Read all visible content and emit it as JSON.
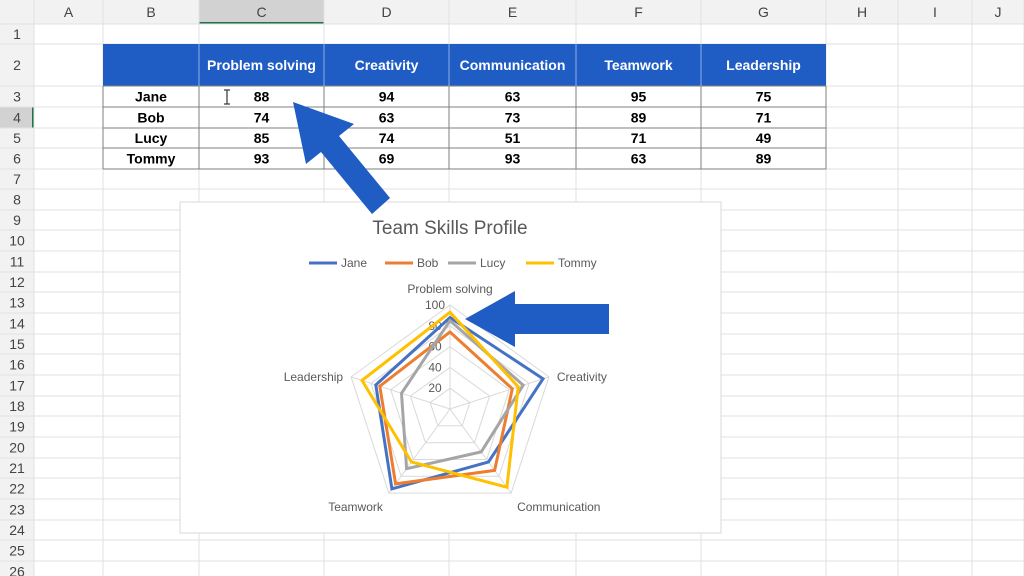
{
  "sheet": {
    "columns": [
      "A",
      "B",
      "C",
      "D",
      "E",
      "F",
      "G",
      "H",
      "I",
      "J"
    ],
    "rows": [
      "1",
      "2",
      "3",
      "4",
      "5",
      "6",
      "7",
      "8",
      "9",
      "10",
      "11",
      "12",
      "13",
      "14",
      "15",
      "16",
      "17",
      "18",
      "19",
      "20",
      "21",
      "22",
      "23",
      "24",
      "25",
      "26"
    ],
    "selected_column": "C",
    "selected_row": "4"
  },
  "table": {
    "headers": [
      "Problem solving",
      "Creativity",
      "Communication",
      "Teamwork",
      "Leadership"
    ],
    "header_bg": "#1f5cc4",
    "rows": [
      {
        "name": "Jane",
        "values": [
          "88",
          "94",
          "63",
          "95",
          "75"
        ]
      },
      {
        "name": "Bob",
        "values": [
          "74",
          "63",
          "73",
          "89",
          "71"
        ]
      },
      {
        "name": "Lucy",
        "values": [
          "85",
          "74",
          "51",
          "71",
          "49"
        ]
      },
      {
        "name": "Tommy",
        "values": [
          "93",
          "69",
          "93",
          "63",
          "89"
        ]
      }
    ]
  },
  "chart_data": {
    "type": "radar",
    "title": "Team Skills Profile",
    "axes": [
      "Problem solving",
      "Creativity",
      "Communication",
      "Teamwork",
      "Leadership"
    ],
    "ticks": [
      "20",
      "40",
      "60",
      "80",
      "100"
    ],
    "rmax": 100,
    "legend_position": "top",
    "series": [
      {
        "name": "Jane",
        "color": "#4472c4",
        "values": [
          88,
          94,
          63,
          95,
          75
        ]
      },
      {
        "name": "Bob",
        "color": "#ed7d31",
        "values": [
          74,
          63,
          73,
          89,
          71
        ]
      },
      {
        "name": "Lucy",
        "color": "#a5a5a5",
        "values": [
          85,
          74,
          51,
          71,
          49
        ]
      },
      {
        "name": "Tommy",
        "color": "#ffc000",
        "values": [
          93,
          69,
          93,
          63,
          89
        ]
      }
    ]
  },
  "annotations": {
    "arrow_color": "#1f5cc4",
    "cursor_icon": "text-cursor-icon"
  }
}
